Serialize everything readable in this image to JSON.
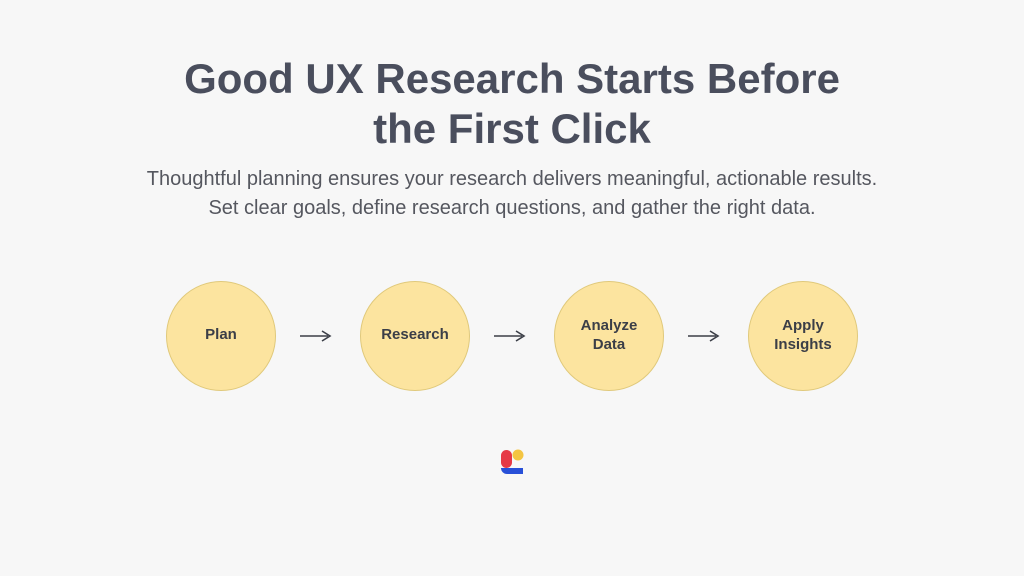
{
  "header": {
    "title": "Good UX Research Starts Before the First Click",
    "subtitle": "Thoughtful planning ensures your research delivers meaningful, actionable results. Set clear goals, define research questions, and gather the right data."
  },
  "flow": {
    "steps": [
      {
        "label": "Plan"
      },
      {
        "label": "Research"
      },
      {
        "label": "Analyze Data"
      },
      {
        "label": "Apply Insights"
      }
    ]
  },
  "colors": {
    "step_fill": "#fce49f",
    "step_border": "#e0c97b",
    "arrow": "#3b3e47",
    "title": "#4a4e5d",
    "subtitle": "#55575f"
  }
}
